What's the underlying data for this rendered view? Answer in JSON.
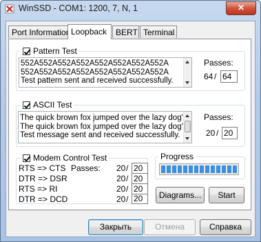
{
  "window": {
    "title": "WinSSD - COM1: 1200, 7, N, 1",
    "close_label": "✕"
  },
  "tabs": [
    {
      "label": "Port Information",
      "active": false
    },
    {
      "label": "Loopback",
      "active": true
    },
    {
      "label": "BERT",
      "active": false
    },
    {
      "label": "Terminal",
      "active": false
    }
  ],
  "pattern_test": {
    "title": "Pattern Test",
    "checked": true,
    "lines": [
      "552A552A552A552A552A552A552A552A",
      "552A552A552A552A552A552A552A552A",
      "Test pattern sent and received successfully."
    ],
    "passes_label": "Passes:",
    "passes_done": "64",
    "passes_sep": "/",
    "passes_total": "64"
  },
  "ascii_test": {
    "title": "ASCII Test",
    "checked": true,
    "lines": [
      "The quick brown fox jumped over the lazy dog's",
      "The quick brown fox jumped over the lazy dog's",
      "Test message sent and received successfully."
    ],
    "passes_label": "Passes:",
    "passes_done": "20",
    "passes_sep": "/",
    "passes_total": "20"
  },
  "modem_test": {
    "title": "Modem Control Test",
    "checked": true,
    "passes_label": "Passes:",
    "rows": [
      {
        "signal": "RTS => CTS",
        "done": "20",
        "sep": "/",
        "total": "20"
      },
      {
        "signal": "DTR => DSR",
        "done": "20",
        "sep": "/",
        "total": "20"
      },
      {
        "signal": "RTS => RI",
        "done": "20",
        "sep": "/",
        "total": "20"
      },
      {
        "signal": "DTR => DCD",
        "done": "20",
        "sep": "/",
        "total": "20"
      }
    ]
  },
  "progress": {
    "title": "Progress",
    "value": 1.0
  },
  "buttons": {
    "diagrams": "Diagrams...",
    "start": "Start",
    "close": "Закрыть",
    "cancel": "Отмена",
    "help": "Справка"
  },
  "colors": {
    "progress_fill": "#3a8fe3",
    "close_button": "#c0341f"
  }
}
